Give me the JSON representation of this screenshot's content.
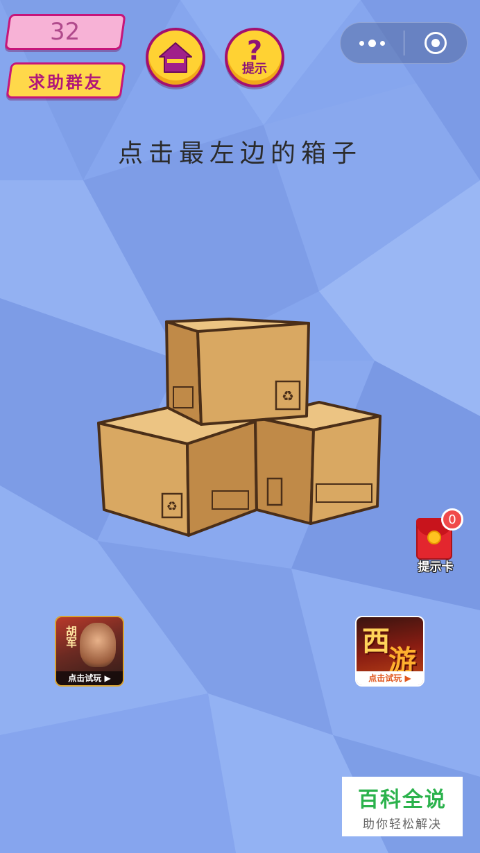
{
  "header": {
    "level": "32",
    "help_label": "求助群友",
    "hint_label": "提示"
  },
  "question": "点击最左边的箱子",
  "hint_card": {
    "label": "提示卡",
    "count": "0"
  },
  "ads": {
    "left": {
      "name": "胡军",
      "cta": "点击试玩 ▶"
    },
    "right": {
      "title_1": "西",
      "title_2": "游",
      "cta": "点击试玩 ▶"
    }
  },
  "watermark": {
    "title": "百科全说",
    "subtitle": "助你轻松解决"
  },
  "colors": {
    "background": "#86a6ee",
    "accent_pink": "#c6157a",
    "button_yellow": "#ffd233",
    "box_tan": "#d8a863"
  },
  "icons": [
    "home-icon",
    "question-icon",
    "more-dots-icon",
    "target-icon",
    "red-envelope-icon",
    "recycle-icon"
  ]
}
